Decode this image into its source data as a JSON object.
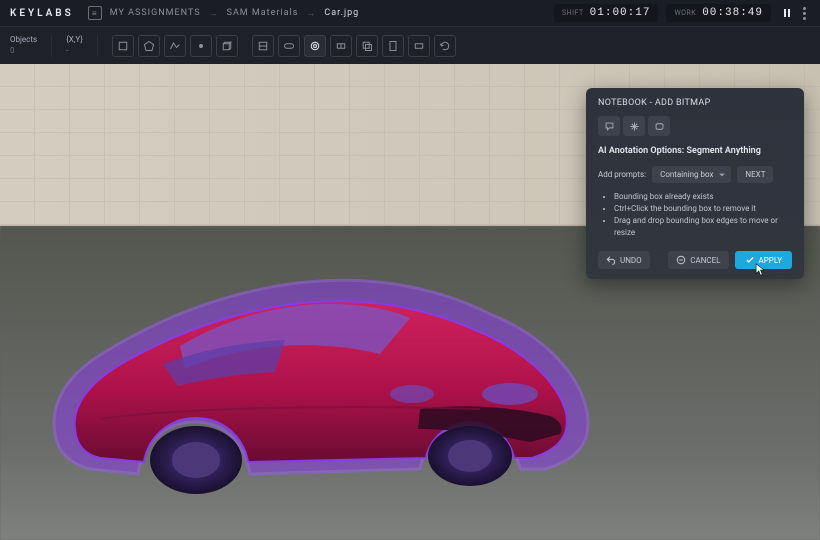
{
  "header": {
    "logo": "KEYLABS",
    "crumbs": {
      "assignments": "MY ASSIGNMENTS",
      "folder": "SAM Materials",
      "file": "Car.jpg"
    },
    "timers": {
      "shift_label": "SHIFT",
      "shift_val": "01:00:17",
      "work_label": "WORK",
      "work_val": "00:38:49"
    }
  },
  "toolbar": {
    "objects_label": "Objects",
    "objects_count": "0",
    "coord_label": "{X,Y}",
    "coord_val": "-",
    "icons": {
      "t1": "bbox-tool-icon",
      "t2": "polygon-tool-icon",
      "t3": "polyline-tool-icon",
      "t4": "point-tool-icon",
      "t5": "cuboid-tool-icon",
      "t6": "brush-tool-icon",
      "t7": "ellipse-tool-icon",
      "t8": "magic-wand-icon",
      "t9": "skeleton-tool-icon",
      "t10": "copy-tool-icon",
      "t11": "edit-tool-icon",
      "t12": "delete-tool-icon",
      "t13": "refresh-tool-icon"
    }
  },
  "panel": {
    "title": "NOTEBOOK - ADD BITMAP",
    "heading": "AI Anotation Options: Segment Anything",
    "prompt_label": "Add prompts:",
    "select_value": "Containing box",
    "next_label": "NEXT",
    "hints": [
      "Bounding box already exists",
      "Ctrl+Click the bounding box to remove it",
      "Drag and drop bounding box edges to move or resize"
    ],
    "undo_label": "UNDO",
    "cancel_label": "CANCEL",
    "apply_label": "APPLY",
    "icons": {
      "i1": "chat-icon",
      "i2": "sparkle-icon",
      "i3": "mask-icon"
    }
  }
}
